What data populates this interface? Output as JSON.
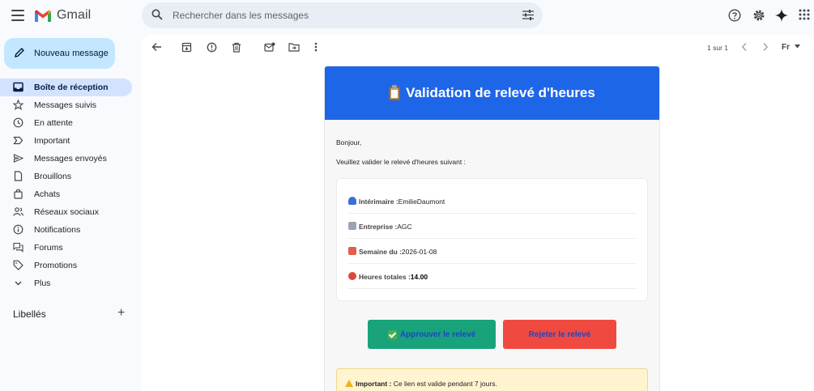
{
  "app": {
    "name": "Gmail"
  },
  "search": {
    "placeholder": "Rechercher dans les messages"
  },
  "compose": {
    "label": "Nouveau message"
  },
  "sidebar": {
    "items": [
      {
        "label": "Boîte de réception",
        "icon": "inbox-icon",
        "active": true
      },
      {
        "label": "Messages suivis",
        "icon": "star-icon"
      },
      {
        "label": "En attente",
        "icon": "clock-icon"
      },
      {
        "label": "Important",
        "icon": "important-icon"
      },
      {
        "label": "Messages envoyés",
        "icon": "send-icon"
      },
      {
        "label": "Brouillons",
        "icon": "draft-icon"
      },
      {
        "label": "Achats",
        "icon": "shopping-bag-icon"
      },
      {
        "label": "Réseaux sociaux",
        "icon": "people-icon"
      },
      {
        "label": "Notifications",
        "icon": "info-icon"
      },
      {
        "label": "Forums",
        "icon": "forum-icon"
      },
      {
        "label": "Promotions",
        "icon": "tag-icon"
      },
      {
        "label": "Plus",
        "icon": "chevron-down-icon"
      }
    ],
    "labels_title": "Libellés"
  },
  "toolbar": {
    "pager": "1 sur 1",
    "language": "Fr"
  },
  "email": {
    "title": "Validation de relevé d'heures",
    "greeting": "Bonjour,",
    "intro": "Veuillez valider le relevé d'heures suivant :",
    "fields": [
      {
        "key": "Intérimaire :",
        "value": "EmilieDaumont",
        "icon": "person-icon",
        "icon_color": "#3b6fd8"
      },
      {
        "key": "Entreprise :",
        "value": "AGC",
        "icon": "office-building-icon",
        "icon_color": "#9aa4b4"
      },
      {
        "key": "Semaine du :",
        "value": "2026-01-08",
        "icon": "calendar-icon",
        "icon_color": "#e35d4f"
      },
      {
        "key": "Heures totales :",
        "value": "14.00",
        "icon": "alarm-clock-icon",
        "icon_color": "#e0463a"
      }
    ],
    "approve_label": "Approuver le relevé",
    "reject_label": "Rejeter le relevé",
    "warning_strong": "Important :",
    "warning_text": " Ce lien est valide pendant 7 jours."
  },
  "colors": {
    "header_blue": "#1e66e8",
    "approve_green": "#19a37a",
    "reject_red": "#f04a40",
    "warning_bg": "#fff4cf",
    "compose_bg": "#c2e7ff",
    "active_nav": "#d3e3fd"
  }
}
